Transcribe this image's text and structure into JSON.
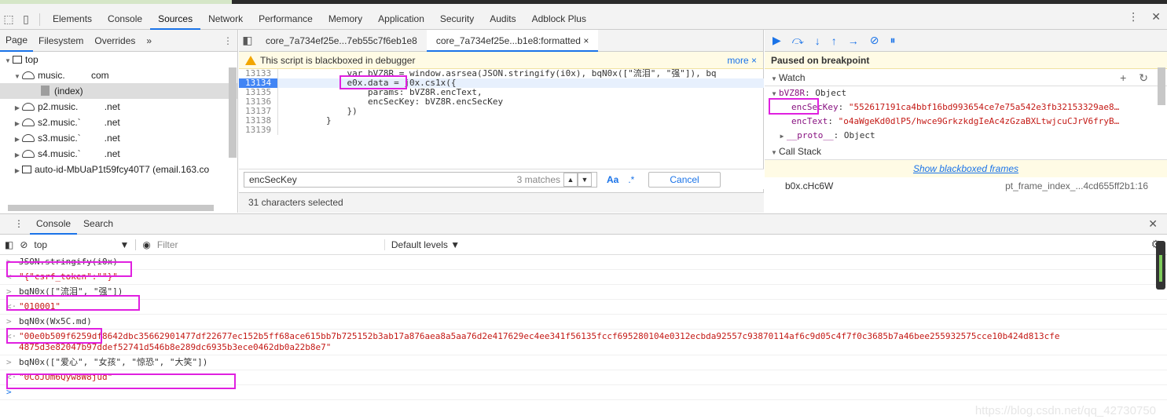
{
  "topbar": {
    "tabs": [
      "Elements",
      "Console",
      "Sources",
      "Network",
      "Performance",
      "Memory",
      "Application",
      "Security",
      "Audits",
      "Adblock Plus"
    ],
    "active_tab": "Sources"
  },
  "navigator": {
    "tabs": [
      "Page",
      "Filesystem",
      "Overrides"
    ],
    "more": "»",
    "tree": [
      {
        "label": "top",
        "type": "frame",
        "indent": 0,
        "expanded": true
      },
      {
        "label": "music.          com",
        "type": "cloud",
        "indent": 1,
        "expanded": true
      },
      {
        "label": "(index)",
        "type": "file",
        "indent": 3,
        "selected": true
      },
      {
        "label": "p2.music.          .net",
        "type": "cloud",
        "indent": 1
      },
      {
        "label": "s2.music.`         .net",
        "type": "cloud",
        "indent": 1
      },
      {
        "label": "s3.music.`         .net",
        "type": "cloud",
        "indent": 1
      },
      {
        "label": "s4.music.`         .net",
        "type": "cloud",
        "indent": 1
      },
      {
        "label": "auto-id-MbUaP1t59fcy40T7 (email.163.co",
        "type": "frame",
        "indent": 1
      }
    ]
  },
  "editor": {
    "tabs": [
      "core_7a734ef25e...7eb55c7f6eb1e8",
      "core_7a734ef25e...b1e8:formatted ×"
    ],
    "banner": "This script is blackboxed in debugger",
    "banner_more": "more ×",
    "lines": [
      {
        "n": "13133",
        "code": "            var bVZ8R = window.asrsea(JSON.stringify(i0x), bqN0x([\"流泪\", \"强\"]), bq"
      },
      {
        "n": "13134",
        "code": "            e0x.data = j0x.cs1x({",
        "exec": true
      },
      {
        "n": "13135",
        "code": "                params: bVZ8R.encText,"
      },
      {
        "n": "13136",
        "code": "                encSecKey: bVZ8R.encSecKey"
      },
      {
        "n": "13137",
        "code": "            })"
      },
      {
        "n": "13138",
        "code": "        }"
      },
      {
        "n": "13139",
        "code": ""
      }
    ],
    "search_value": "encSecKey",
    "search_matches": "3 matches",
    "case_label": "Aa",
    "regex_label": ".*",
    "cancel_label": "Cancel",
    "status": "31 characters selected"
  },
  "debugger": {
    "paused": "Paused on breakpoint",
    "watch_title": "Watch",
    "watch": [
      {
        "key": "bVZ8R",
        "val": "Object",
        "kind": "obj"
      },
      {
        "key": "encSecKey",
        "val": "\"552617191ca4bbf16bd993654ce7e75a542e3fb32153329ae8…",
        "kind": "str"
      },
      {
        "key": "encText",
        "val": "\"o4aWgeKd0dlP5/hwce9GrkzkdgIeAc4zGzaBXLtwjcuCJrV6fryB…",
        "kind": "str"
      },
      {
        "key": "__proto__",
        "val": "Object",
        "kind": "proto"
      }
    ],
    "callstack_title": "Call Stack",
    "show_blackboxed": "Show blackboxed frames",
    "frame_fn": "b0x.cHc6W",
    "frame_loc": "pt_frame_index_...4cd655ff2b1:16"
  },
  "drawer": {
    "tabs": [
      "Console",
      "Search"
    ],
    "context": "top",
    "filter_placeholder": "Filter",
    "levels": "Default levels ▼",
    "messages": [
      {
        "kind": "in",
        "text": "JSON.stringify(i0x)"
      },
      {
        "kind": "out",
        "text": "\"{\"csrf_token\":\"\"}\""
      },
      {
        "kind": "in",
        "text": "bqN0x([\"流泪\", \"强\"])"
      },
      {
        "kind": "out",
        "text": "\"010001\""
      },
      {
        "kind": "in",
        "text": "bqN0x(Wx5C.md)"
      },
      {
        "kind": "out",
        "text": "\"00e0b509f6259df8642dbc35662901477df22677ec152b5ff68ace615bb7b725152b3ab17a876aea8a5aa76d2e417629ec4ee341f56135fccf695280104e0312ecbda92557c93870114af6c9d05c4f7f0c3685b7a46bee255932575cce10b424d813cfe\n4875d3e82047b97ddef52741d546b8e289dc6935b3ece0462db0a22b8e7\""
      },
      {
        "kind": "in",
        "text": "bqN0x([\"爱心\", \"女孩\", \"惊恐\", \"大笑\"])"
      },
      {
        "kind": "out",
        "text": "\"0CoJUm6Qyw8W8jud\""
      }
    ]
  },
  "watermark": "https://blog.csdn.net/qq_42730750"
}
